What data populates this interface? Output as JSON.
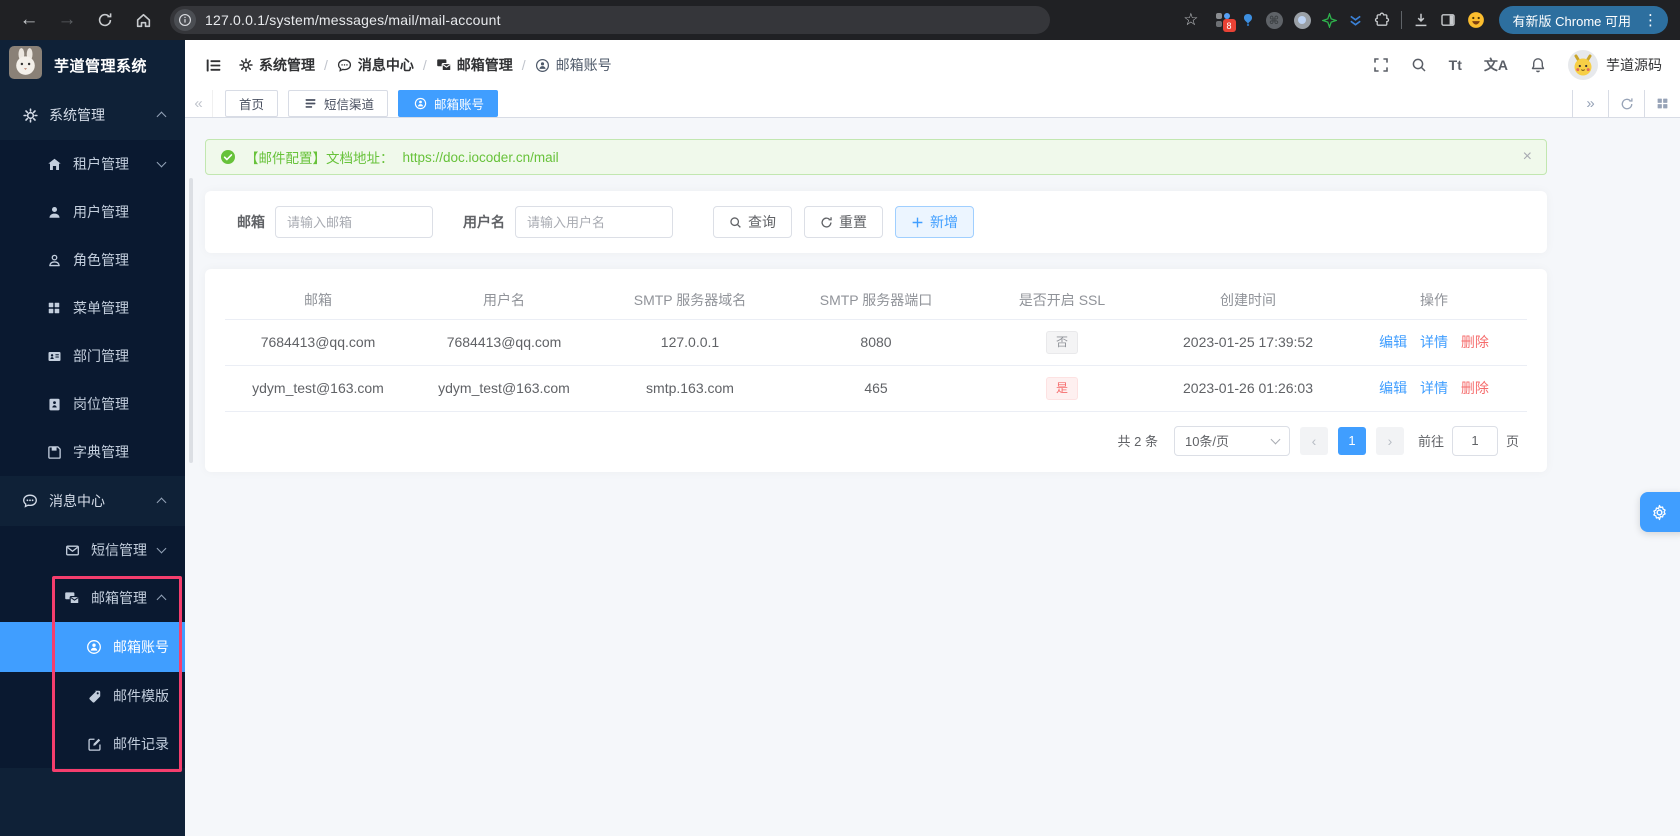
{
  "browser": {
    "url": "127.0.0.1/system/messages/mail/mail-account",
    "ext_badge": "8",
    "update_label": "有新版 Chrome 可用"
  },
  "icons": {
    "back": "←",
    "forward": "→",
    "star": "☆",
    "cmd": "⌘",
    "more": "⋮",
    "close": "×",
    "prev": "‹",
    "next": "›",
    "collapse": "«",
    "expand": "»"
  },
  "sidebar": {
    "logo_title": "芋道管理系统",
    "items": [
      {
        "label": "系统管理"
      },
      {
        "label": "租户管理"
      },
      {
        "label": "用户管理"
      },
      {
        "label": "角色管理"
      },
      {
        "label": "菜单管理"
      },
      {
        "label": "部门管理"
      },
      {
        "label": "岗位管理"
      },
      {
        "label": "字典管理"
      },
      {
        "label": "消息中心"
      },
      {
        "label": "短信管理"
      },
      {
        "label": "邮箱管理"
      },
      {
        "label": "邮箱账号"
      },
      {
        "label": "邮件模版"
      },
      {
        "label": "邮件记录"
      }
    ]
  },
  "header": {
    "breadcrumb": [
      {
        "label": "系统管理"
      },
      {
        "label": "消息中心"
      },
      {
        "label": "邮箱管理"
      },
      {
        "label": "邮箱账号"
      }
    ],
    "separator": "/",
    "fontsize_glyph": "Tt",
    "lang_glyph": "文A",
    "username": "芋道源码"
  },
  "tabbar": {
    "tabs": [
      {
        "label": "首页"
      },
      {
        "label": "短信渠道"
      },
      {
        "label": "邮箱账号"
      }
    ]
  },
  "alert": {
    "text": "【邮件配置】文档地址：",
    "link": "https://doc.iocoder.cn/mail"
  },
  "search": {
    "email_label": "邮箱",
    "email_placeholder": "请输入邮箱",
    "username_label": "用户名",
    "username_placeholder": "请输入用户名",
    "query_label": "查询",
    "reset_label": "重置",
    "add_label": "新增"
  },
  "table": {
    "headers": [
      "邮箱",
      "用户名",
      "SMTP 服务器域名",
      "SMTP 服务器端口",
      "是否开启 SSL",
      "创建时间",
      "操作"
    ],
    "action_edit": "编辑",
    "action_detail": "详情",
    "action_delete": "删除",
    "rows": [
      {
        "email": "7684413@qq.com",
        "username": "7684413@qq.com",
        "host": "127.0.0.1",
        "port": "8080",
        "ssl": "否",
        "created": "2023-01-25 17:39:52"
      },
      {
        "email": "ydym_test@163.com",
        "username": "ydym_test@163.com",
        "host": "smtp.163.com",
        "port": "465",
        "ssl": "是",
        "created": "2023-01-26 01:26:03"
      }
    ]
  },
  "pagination": {
    "total": "共 2 条",
    "page_size": "10条/页",
    "current": "1",
    "goto_label": "前往",
    "goto_value": "1",
    "unit_label": "页"
  },
  "colors": {
    "primary": "#409eff",
    "success": "#67c23a",
    "danger": "#f56c6c",
    "annotation_box": "#f53e6d",
    "sidebar_bg": "#0f2137",
    "chrome_bg": "#202124",
    "update_pill": "#2d6f9f"
  }
}
